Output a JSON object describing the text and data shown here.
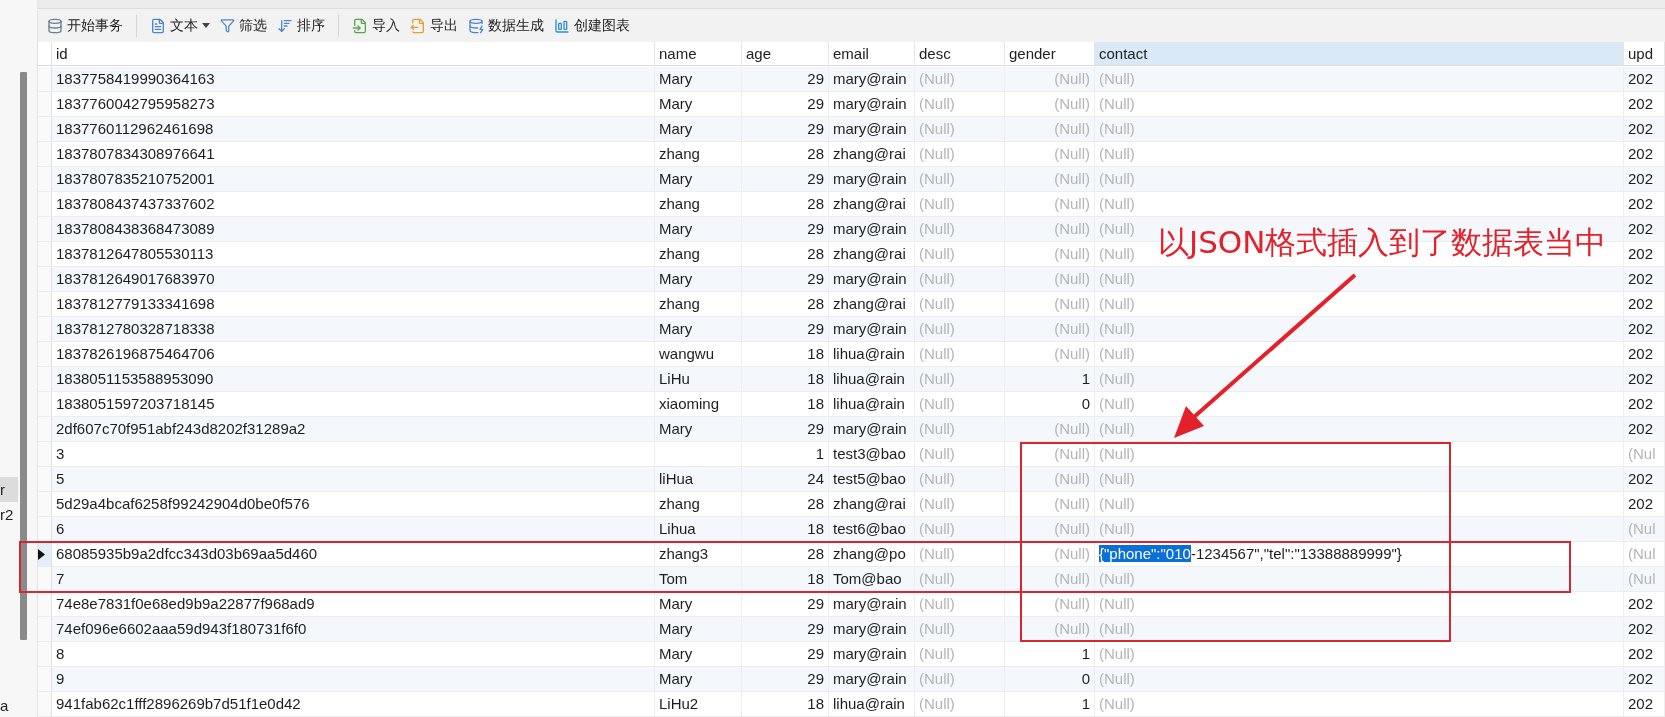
{
  "sidebar": {
    "items": [
      {
        "label": "r",
        "selected": true
      },
      {
        "label": "r2",
        "selected": false
      },
      {
        "label": "a",
        "selected": false
      }
    ]
  },
  "toolbar": {
    "groups": [
      [
        {
          "label": "开始事务"
        }
      ],
      [
        {
          "label": "文本",
          "dropdown": true
        },
        {
          "label": "筛选"
        },
        {
          "label": "排序"
        }
      ],
      [
        {
          "label": "导入"
        },
        {
          "label": "导出"
        },
        {
          "label": "数据生成"
        },
        {
          "label": "创建图表"
        }
      ]
    ]
  },
  "table": {
    "columns": [
      {
        "label": "id",
        "kind": "text",
        "selected": false
      },
      {
        "label": "name",
        "kind": "text",
        "selected": false
      },
      {
        "label": "age",
        "kind": "number",
        "selected": false
      },
      {
        "label": "email",
        "kind": "text",
        "selected": false
      },
      {
        "label": "desc",
        "kind": "text",
        "selected": false
      },
      {
        "label": "gender",
        "kind": "number",
        "selected": false
      },
      {
        "label": "contact",
        "kind": "text",
        "selected": true
      },
      {
        "label": "upd",
        "kind": "text",
        "selected": false
      }
    ],
    "rows": [
      {
        "selected": false,
        "cells": [
          "1837758419990364163",
          "Mary",
          "29",
          "mary@rain",
          {
            "text": "(Null)",
            "kind": "null"
          },
          {
            "text": "(Null)",
            "kind": "null"
          },
          {
            "text": "(Null)",
            "kind": "null"
          },
          "202"
        ]
      },
      {
        "selected": false,
        "cells": [
          "1837760042795958273",
          "Mary",
          "29",
          "mary@rain",
          {
            "text": "(Null)",
            "kind": "null"
          },
          {
            "text": "(Null)",
            "kind": "null"
          },
          {
            "text": "(Null)",
            "kind": "null"
          },
          "202"
        ]
      },
      {
        "selected": false,
        "cells": [
          "1837760112962461698",
          "Mary",
          "29",
          "mary@rain",
          {
            "text": "(Null)",
            "kind": "null"
          },
          {
            "text": "(Null)",
            "kind": "null"
          },
          {
            "text": "(Null)",
            "kind": "null"
          },
          "202"
        ]
      },
      {
        "selected": false,
        "cells": [
          "1837807834308976641",
          "zhang",
          "28",
          "zhang@rai",
          {
            "text": "(Null)",
            "kind": "null"
          },
          {
            "text": "(Null)",
            "kind": "null"
          },
          {
            "text": "(Null)",
            "kind": "null"
          },
          "202"
        ]
      },
      {
        "selected": false,
        "cells": [
          "1837807835210752001",
          "Mary",
          "29",
          "mary@rain",
          {
            "text": "(Null)",
            "kind": "null"
          },
          {
            "text": "(Null)",
            "kind": "null"
          },
          {
            "text": "(Null)",
            "kind": "null"
          },
          "202"
        ]
      },
      {
        "selected": false,
        "cells": [
          "1837808437437337602",
          "zhang",
          "28",
          "zhang@rai",
          {
            "text": "(Null)",
            "kind": "null"
          },
          {
            "text": "(Null)",
            "kind": "null"
          },
          {
            "text": "(Null)",
            "kind": "null"
          },
          "202"
        ]
      },
      {
        "selected": false,
        "cells": [
          "1837808438368473089",
          "Mary",
          "29",
          "mary@rain",
          {
            "text": "(Null)",
            "kind": "null"
          },
          {
            "text": "(Null)",
            "kind": "null"
          },
          {
            "text": "(Null)",
            "kind": "null"
          },
          "202"
        ]
      },
      {
        "selected": false,
        "cells": [
          "1837812647805530113",
          "zhang",
          "28",
          "zhang@rai",
          {
            "text": "(Null)",
            "kind": "null"
          },
          {
            "text": "(Null)",
            "kind": "null"
          },
          {
            "text": "(Null)",
            "kind": "null"
          },
          "202"
        ]
      },
      {
        "selected": false,
        "cells": [
          "1837812649017683970",
          "Mary",
          "29",
          "mary@rain",
          {
            "text": "(Null)",
            "kind": "null"
          },
          {
            "text": "(Null)",
            "kind": "null"
          },
          {
            "text": "(Null)",
            "kind": "null"
          },
          "202"
        ]
      },
      {
        "selected": false,
        "cells": [
          "1837812779133341698",
          "zhang",
          "28",
          "zhang@rai",
          {
            "text": "(Null)",
            "kind": "null"
          },
          {
            "text": "(Null)",
            "kind": "null"
          },
          {
            "text": "(Null)",
            "kind": "null"
          },
          "202"
        ]
      },
      {
        "selected": false,
        "cells": [
          "1837812780328718338",
          "Mary",
          "29",
          "mary@rain",
          {
            "text": "(Null)",
            "kind": "null"
          },
          {
            "text": "(Null)",
            "kind": "null"
          },
          {
            "text": "(Null)",
            "kind": "null"
          },
          "202"
        ]
      },
      {
        "selected": false,
        "cells": [
          "1837826196875464706",
          "wangwu",
          "18",
          "lihua@rain",
          {
            "text": "(Null)",
            "kind": "null"
          },
          {
            "text": "(Null)",
            "kind": "null"
          },
          {
            "text": "(Null)",
            "kind": "null"
          },
          "202"
        ]
      },
      {
        "selected": false,
        "cells": [
          "1838051153588953090",
          "LiHu",
          "18",
          "lihua@rain",
          {
            "text": "(Null)",
            "kind": "null"
          },
          "1",
          {
            "text": "(Null)",
            "kind": "null"
          },
          "202"
        ]
      },
      {
        "selected": false,
        "cells": [
          "1838051597203718145",
          "xiaoming",
          "18",
          "lihua@rain",
          {
            "text": "(Null)",
            "kind": "null"
          },
          "0",
          {
            "text": "(Null)",
            "kind": "null"
          },
          "202"
        ]
      },
      {
        "selected": false,
        "cells": [
          "2df607c70f951abf243d8202f31289a2",
          "Mary",
          "29",
          "mary@rain",
          {
            "text": "(Null)",
            "kind": "null"
          },
          {
            "text": "(Null)",
            "kind": "null"
          },
          {
            "text": "(Null)",
            "kind": "null"
          },
          "202"
        ]
      },
      {
        "selected": false,
        "cells": [
          "3",
          null,
          "1",
          "test3@bao",
          {
            "text": "(Null)",
            "kind": "null"
          },
          {
            "text": "(Null)",
            "kind": "null"
          },
          {
            "text": "(Null)",
            "kind": "null"
          },
          {
            "text": "(Nul",
            "kind": "null"
          }
        ]
      },
      {
        "selected": false,
        "cells": [
          "5",
          "liHua",
          "24",
          "test5@bao",
          {
            "text": "(Null)",
            "kind": "null"
          },
          {
            "text": "(Null)",
            "kind": "null"
          },
          {
            "text": "(Null)",
            "kind": "null"
          },
          "202"
        ]
      },
      {
        "selected": false,
        "cells": [
          "5d29a4bcaf6258f99242904d0be0f576",
          "zhang",
          "28",
          "zhang@rai",
          {
            "text": "(Null)",
            "kind": "null"
          },
          {
            "text": "(Null)",
            "kind": "null"
          },
          {
            "text": "(Null)",
            "kind": "null"
          },
          "202"
        ]
      },
      {
        "selected": false,
        "cells": [
          "6",
          "Lihua",
          "18",
          "test6@bao",
          {
            "text": "(Null)",
            "kind": "null"
          },
          {
            "text": "(Null)",
            "kind": "null"
          },
          {
            "text": "(Null)",
            "kind": "null"
          },
          {
            "text": "(Nul",
            "kind": "null"
          }
        ]
      },
      {
        "selected": true,
        "cells": [
          "68085935b9a2dfcc343d03b69aa5d460",
          "zhang3",
          "28",
          "zhang@po",
          {
            "text": "(Null)",
            "kind": "null"
          },
          {
            "text": "(Null)",
            "kind": "null"
          },
          {
            "highlight": "{\"phone\":\"010",
            "text": "-1234567\",\"tel\":\"13388889999\"}",
            "kind": "json"
          },
          {
            "text": "(Nul",
            "kind": "null"
          }
        ]
      },
      {
        "selected": false,
        "cells": [
          "7",
          "Tom",
          "18",
          "Tom@bao",
          {
            "text": "(Null)",
            "kind": "null"
          },
          {
            "text": "(Null)",
            "kind": "null"
          },
          {
            "text": "(Null)",
            "kind": "null"
          },
          {
            "text": "(Nul",
            "kind": "null"
          }
        ]
      },
      {
        "selected": false,
        "cells": [
          "74e8e7831f0e68ed9b9a22877f968ad9",
          "Mary",
          "29",
          "mary@rain",
          {
            "text": "(Null)",
            "kind": "null"
          },
          {
            "text": "(Null)",
            "kind": "null"
          },
          {
            "text": "(Null)",
            "kind": "null"
          },
          "202"
        ]
      },
      {
        "selected": false,
        "cells": [
          "74ef096e6602aaa59d943f180731f6f0",
          "Mary",
          "29",
          "mary@rain",
          {
            "text": "(Null)",
            "kind": "null"
          },
          {
            "text": "(Null)",
            "kind": "null"
          },
          {
            "text": "(Null)",
            "kind": "null"
          },
          "202"
        ]
      },
      {
        "selected": false,
        "cells": [
          "8",
          "Mary",
          "29",
          "mary@rain",
          {
            "text": "(Null)",
            "kind": "null"
          },
          "1",
          {
            "text": "(Null)",
            "kind": "null"
          },
          "202"
        ]
      },
      {
        "selected": false,
        "cells": [
          "9",
          "Mary",
          "29",
          "mary@rain",
          {
            "text": "(Null)",
            "kind": "null"
          },
          "0",
          {
            "text": "(Null)",
            "kind": "null"
          },
          "202"
        ]
      },
      {
        "selected": false,
        "cells": [
          "941fab62c1fff2896269b7d51f1e0d42",
          "LiHu2",
          "18",
          "lihua@rain",
          {
            "text": "(Null)",
            "kind": "null"
          },
          "1",
          {
            "text": "(Null)",
            "kind": "null"
          },
          "202"
        ]
      }
    ]
  },
  "annotation": {
    "caption": "以JSON格式插入到了数据表当中"
  }
}
